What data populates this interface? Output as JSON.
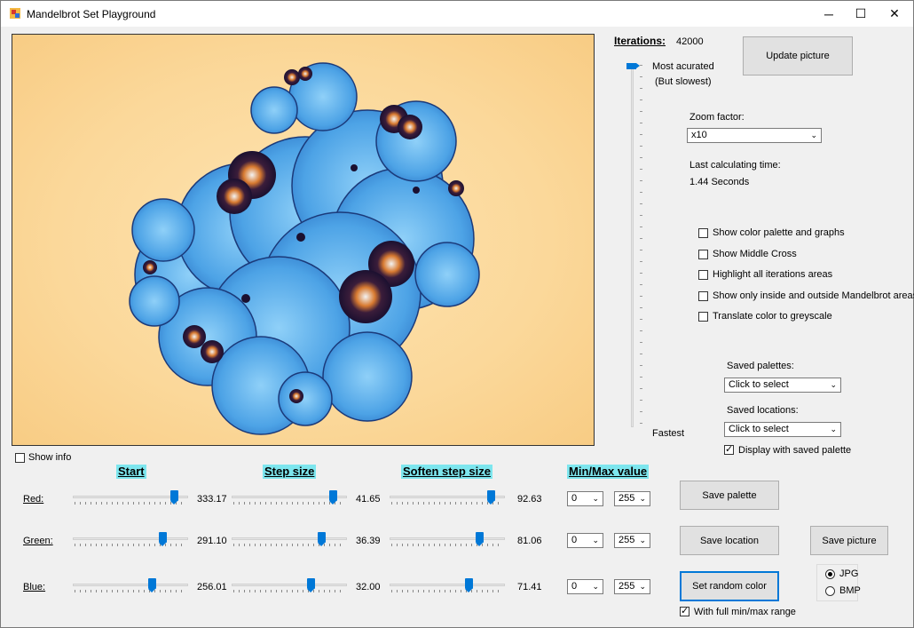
{
  "window": {
    "title": "Mandelbrot Set Playground",
    "min": "─",
    "max": "☐",
    "close": "✕"
  },
  "iterations": {
    "label": "Iterations:",
    "value": "42000",
    "top_label": "Most acurated",
    "top_sub": "(But slowest)",
    "bottom_label": "Fastest",
    "slider_level": 0.0
  },
  "update_button": "Update picture",
  "zoom": {
    "label": "Zoom factor:",
    "value": "x10"
  },
  "calc": {
    "label": "Last calculating time:",
    "value": "1.44 Seconds"
  },
  "options": [
    {
      "label": "Show color palette and graphs",
      "checked": false
    },
    {
      "label": "Show Middle Cross",
      "checked": false
    },
    {
      "label": "Highlight all iterations areas",
      "checked": false
    },
    {
      "label": "Show only inside and outside Mandelbrot areas",
      "checked": false
    },
    {
      "label": "Translate color to greyscale",
      "checked": false
    }
  ],
  "saved_palettes": {
    "label": "Saved palettes:",
    "value": "Click to select"
  },
  "saved_locations": {
    "label": "Saved locations:",
    "value": "Click to select"
  },
  "display_saved_palette": {
    "label": "Display with saved palette",
    "checked": true
  },
  "show_info": {
    "label": "Show info",
    "checked": false
  },
  "headers": {
    "start": "Start",
    "step": "Step size",
    "soften": "Soften step size",
    "minmax": "Min/Max value"
  },
  "rows": [
    {
      "label": "Red:",
      "start": "333.17",
      "start_level": 0.91,
      "step": "41.65",
      "step_level": 0.91,
      "soften": "92.63",
      "soften_level": 0.91,
      "min": "0",
      "max": "255"
    },
    {
      "label": "Green:",
      "start": "291.10",
      "start_level": 0.8,
      "step": "36.39",
      "step_level": 0.8,
      "soften": "81.06",
      "soften_level": 0.8,
      "min": "0",
      "max": "255"
    },
    {
      "label": "Blue:",
      "start": "256.01",
      "start_level": 0.7,
      "step": "32.00",
      "step_level": 0.7,
      "soften": "71.41",
      "soften_level": 0.7,
      "min": "0",
      "max": "255"
    }
  ],
  "buttons": {
    "save_palette": "Save  palette",
    "save_location": "Save location",
    "save_picture": "Save picture",
    "random_color": "Set random color"
  },
  "full_range": {
    "label": "With full min/max range",
    "checked": true
  },
  "format": {
    "jpg": "JPG",
    "bmp": "BMP",
    "selected": "JPG"
  },
  "colors": {
    "accent": "#0078d7",
    "header_bg": "#7de6ee",
    "fractal_light": "#4da3e6",
    "fractal_dark": "#1b3a7a"
  }
}
